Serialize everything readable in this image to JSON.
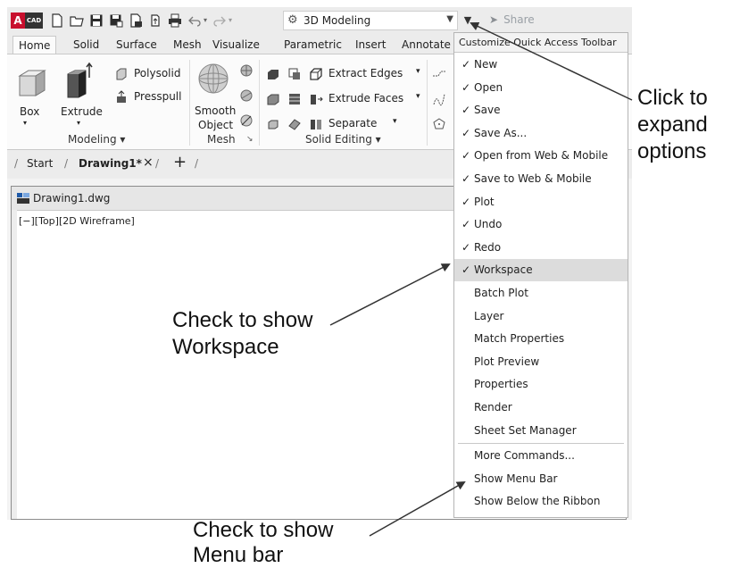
{
  "app": {
    "logo_letter": "A",
    "logo_badge": "CAD",
    "workspace": "3D Modeling",
    "share_label": "Share"
  },
  "tabs": [
    "Home",
    "Solid",
    "Surface",
    "Mesh",
    "Visualize",
    "Parametric",
    "Insert",
    "Annotate"
  ],
  "active_tab": "Home",
  "ribbon": {
    "modeling": {
      "box_label": "Box",
      "extrude_label": "Extrude",
      "polysolid_label": "Polysolid",
      "presspull_label": "Presspull",
      "panel_label": "Modeling ▾"
    },
    "mesh": {
      "smooth_line1": "Smooth",
      "smooth_line2": "Object",
      "panel_label": "Mesh"
    },
    "solid_editing": {
      "extract_edges": "Extract Edges",
      "extrude_faces": "Extrude Faces",
      "separate": "Separate",
      "panel_label": "Solid Editing ▾"
    }
  },
  "file_tabs": {
    "start": "Start",
    "drawing": "Drawing1*",
    "close_glyph": "×",
    "new_glyph": "+"
  },
  "drawing_window": {
    "title": "Drawing1.dwg",
    "view_controls": "[−][Top][2D Wireframe]"
  },
  "menu": {
    "header": "Customize Quick Access Toolbar",
    "items": [
      {
        "label": "New",
        "checked": true
      },
      {
        "label": "Open",
        "checked": true
      },
      {
        "label": "Save",
        "checked": true
      },
      {
        "label": "Save As...",
        "checked": true
      },
      {
        "label": "Open from Web & Mobile",
        "checked": true
      },
      {
        "label": "Save to Web & Mobile",
        "checked": true
      },
      {
        "label": "Plot",
        "checked": true
      },
      {
        "label": "Undo",
        "checked": true
      },
      {
        "label": "Redo",
        "checked": true
      },
      {
        "label": "Workspace",
        "checked": true,
        "highlighted": true
      },
      {
        "label": "Batch Plot",
        "checked": false
      },
      {
        "label": "Layer",
        "checked": false
      },
      {
        "label": "Match Properties",
        "checked": false
      },
      {
        "label": "Plot Preview",
        "checked": false
      },
      {
        "label": "Properties",
        "checked": false
      },
      {
        "label": "Render",
        "checked": false
      },
      {
        "label": "Sheet Set Manager",
        "checked": false
      },
      {
        "label": "More Commands...",
        "checked": false
      },
      {
        "label": "Show Menu Bar",
        "checked": false
      },
      {
        "label": "Show Below the Ribbon",
        "checked": false
      }
    ]
  },
  "annotations": {
    "expand_line1": "Click to",
    "expand_line2": "expand",
    "expand_line3": "options",
    "workspace_line1": "Check to show",
    "workspace_line2": "Workspace",
    "menubar_line1": "Check to show",
    "menubar_line2": "Menu bar"
  },
  "colors": {
    "accent": "#c8102e",
    "highlight": "#dcdcdc",
    "ribbon_bg": "#fbfbfb",
    "toolbar_bg": "#ececec"
  }
}
